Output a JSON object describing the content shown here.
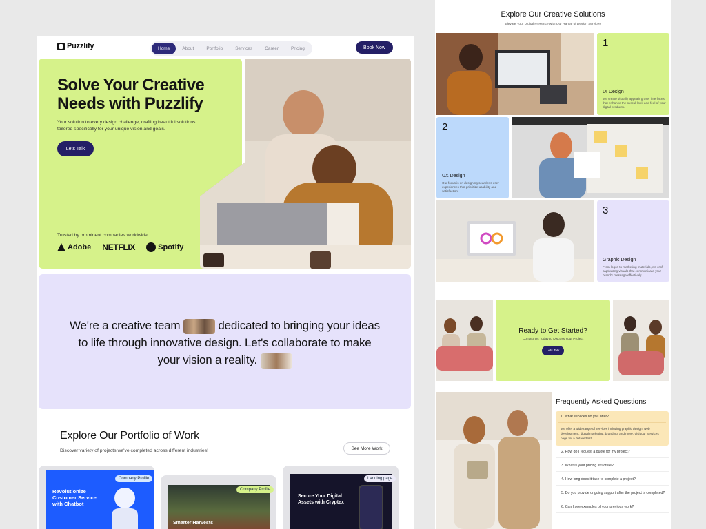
{
  "brand": {
    "name": "Puzzlify"
  },
  "nav": {
    "items": [
      "Home",
      "About",
      "Portfolio",
      "Services",
      "Career",
      "Pricing"
    ],
    "active": "Home",
    "cta": "Book Now"
  },
  "hero": {
    "title_line1": "Solve Your Creative",
    "title_line2": "Needs with Puzzlify",
    "subtitle_line1": "Your solution to every design challenge, crafting beautiful solutions",
    "subtitle_line2": "tailored specifically for your unique vision and goals.",
    "cta": "Lets Talk",
    "trusted": "Trusted by prominent companies worldwide.",
    "logos": [
      "Adobe",
      "NETFLIX",
      "Spotify"
    ]
  },
  "about": {
    "line1a": "We're a creative team",
    "line1b": "dedicated to bringing your ideas",
    "line2": "to life through innovative design. Let's collaborate to make",
    "line3": "your vision a reality."
  },
  "portfolio": {
    "title": "Explore Our Portfolio of Work",
    "subtitle": "Discover variety of projects we've completed across different industries!",
    "cta": "See More Work",
    "cards": [
      {
        "tag": "Company Profile",
        "heading_line1": "Revolutionize",
        "heading_line2": "Customer Service",
        "heading_line3": "with Chatbot"
      },
      {
        "tag": "Company Profile",
        "heading_line1": "Smarter Harvests"
      },
      {
        "tag": "Landing page",
        "heading_line1": "Secure Your Digital",
        "heading_line2": "Assets with Cryptex"
      }
    ]
  },
  "solutions": {
    "title": "Explore Our Creative Solutions",
    "subtitle": "Elevate Your Digital Presence with Our Range of Design Services",
    "items": [
      {
        "num": "1",
        "title": "UI Design",
        "desc": "We create visually appealing user interfaces that enhance the overall look and feel of your digital products."
      },
      {
        "num": "2",
        "title": "UX Design",
        "desc": "Our focus is on designing seamless user experiences that prioritize usability and satisfaction."
      },
      {
        "num": "3",
        "title": "Graphic Design",
        "desc": "From logos to marketing materials, we craft captivating visuals that communicate your brand's message effectively."
      }
    ]
  },
  "cta_block": {
    "title": "Ready to Get Started?",
    "subtitle": "Contact Us Today to Discuss Your Project",
    "button": "Lets Talk"
  },
  "faq": {
    "title": "Frequently Asked Questions",
    "items": [
      {
        "q": "1.  What services do you offer?",
        "a": "We offer a wide range of services including graphic design, web development, digital marketing, branding, and more. Visit our Services page for a detailed list."
      },
      {
        "q": "2.  How do I request a quote for my project?"
      },
      {
        "q": "3.  What is your pricing structure?"
      },
      {
        "q": "4.  How long does it take to complete a project?"
      },
      {
        "q": "5.  Do you provide ongoing support after the project is completed?"
      },
      {
        "q": "6.  Can I see examples of your previous work?"
      }
    ]
  },
  "colors": {
    "lime": "#d6f28a",
    "lavender": "#e6e2fb",
    "navy": "#241f66",
    "sky": "#bcd9fb",
    "cream": "#fbe7b8"
  }
}
